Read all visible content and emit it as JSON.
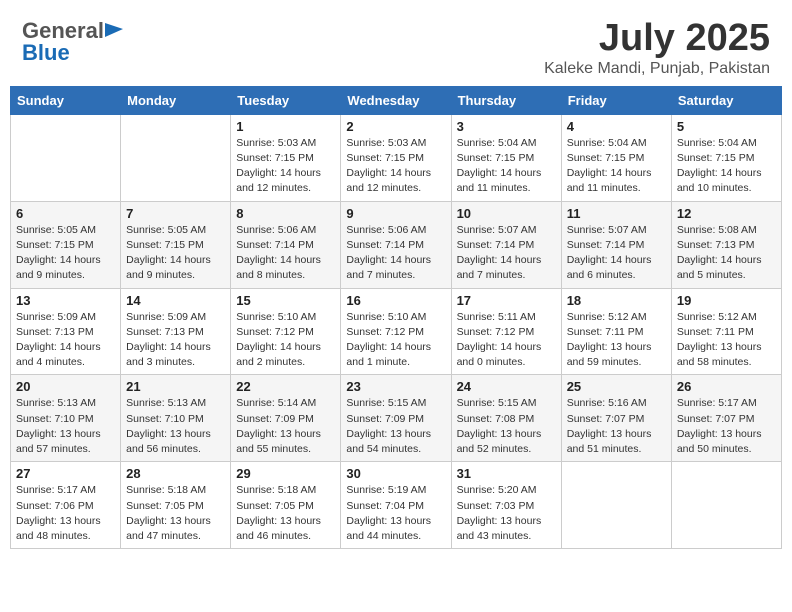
{
  "header": {
    "logo_general": "General",
    "logo_blue": "Blue",
    "month_title": "July 2025",
    "location": "Kaleke Mandi, Punjab, Pakistan"
  },
  "columns": [
    "Sunday",
    "Monday",
    "Tuesday",
    "Wednesday",
    "Thursday",
    "Friday",
    "Saturday"
  ],
  "weeks": [
    [
      {
        "day": "",
        "sunrise": "",
        "sunset": "",
        "daylight": ""
      },
      {
        "day": "",
        "sunrise": "",
        "sunset": "",
        "daylight": ""
      },
      {
        "day": "1",
        "sunrise": "Sunrise: 5:03 AM",
        "sunset": "Sunset: 7:15 PM",
        "daylight": "Daylight: 14 hours and 12 minutes."
      },
      {
        "day": "2",
        "sunrise": "Sunrise: 5:03 AM",
        "sunset": "Sunset: 7:15 PM",
        "daylight": "Daylight: 14 hours and 12 minutes."
      },
      {
        "day": "3",
        "sunrise": "Sunrise: 5:04 AM",
        "sunset": "Sunset: 7:15 PM",
        "daylight": "Daylight: 14 hours and 11 minutes."
      },
      {
        "day": "4",
        "sunrise": "Sunrise: 5:04 AM",
        "sunset": "Sunset: 7:15 PM",
        "daylight": "Daylight: 14 hours and 11 minutes."
      },
      {
        "day": "5",
        "sunrise": "Sunrise: 5:04 AM",
        "sunset": "Sunset: 7:15 PM",
        "daylight": "Daylight: 14 hours and 10 minutes."
      }
    ],
    [
      {
        "day": "6",
        "sunrise": "Sunrise: 5:05 AM",
        "sunset": "Sunset: 7:15 PM",
        "daylight": "Daylight: 14 hours and 9 minutes."
      },
      {
        "day": "7",
        "sunrise": "Sunrise: 5:05 AM",
        "sunset": "Sunset: 7:15 PM",
        "daylight": "Daylight: 14 hours and 9 minutes."
      },
      {
        "day": "8",
        "sunrise": "Sunrise: 5:06 AM",
        "sunset": "Sunset: 7:14 PM",
        "daylight": "Daylight: 14 hours and 8 minutes."
      },
      {
        "day": "9",
        "sunrise": "Sunrise: 5:06 AM",
        "sunset": "Sunset: 7:14 PM",
        "daylight": "Daylight: 14 hours and 7 minutes."
      },
      {
        "day": "10",
        "sunrise": "Sunrise: 5:07 AM",
        "sunset": "Sunset: 7:14 PM",
        "daylight": "Daylight: 14 hours and 7 minutes."
      },
      {
        "day": "11",
        "sunrise": "Sunrise: 5:07 AM",
        "sunset": "Sunset: 7:14 PM",
        "daylight": "Daylight: 14 hours and 6 minutes."
      },
      {
        "day": "12",
        "sunrise": "Sunrise: 5:08 AM",
        "sunset": "Sunset: 7:13 PM",
        "daylight": "Daylight: 14 hours and 5 minutes."
      }
    ],
    [
      {
        "day": "13",
        "sunrise": "Sunrise: 5:09 AM",
        "sunset": "Sunset: 7:13 PM",
        "daylight": "Daylight: 14 hours and 4 minutes."
      },
      {
        "day": "14",
        "sunrise": "Sunrise: 5:09 AM",
        "sunset": "Sunset: 7:13 PM",
        "daylight": "Daylight: 14 hours and 3 minutes."
      },
      {
        "day": "15",
        "sunrise": "Sunrise: 5:10 AM",
        "sunset": "Sunset: 7:12 PM",
        "daylight": "Daylight: 14 hours and 2 minutes."
      },
      {
        "day": "16",
        "sunrise": "Sunrise: 5:10 AM",
        "sunset": "Sunset: 7:12 PM",
        "daylight": "Daylight: 14 hours and 1 minute."
      },
      {
        "day": "17",
        "sunrise": "Sunrise: 5:11 AM",
        "sunset": "Sunset: 7:12 PM",
        "daylight": "Daylight: 14 hours and 0 minutes."
      },
      {
        "day": "18",
        "sunrise": "Sunrise: 5:12 AM",
        "sunset": "Sunset: 7:11 PM",
        "daylight": "Daylight: 13 hours and 59 minutes."
      },
      {
        "day": "19",
        "sunrise": "Sunrise: 5:12 AM",
        "sunset": "Sunset: 7:11 PM",
        "daylight": "Daylight: 13 hours and 58 minutes."
      }
    ],
    [
      {
        "day": "20",
        "sunrise": "Sunrise: 5:13 AM",
        "sunset": "Sunset: 7:10 PM",
        "daylight": "Daylight: 13 hours and 57 minutes."
      },
      {
        "day": "21",
        "sunrise": "Sunrise: 5:13 AM",
        "sunset": "Sunset: 7:10 PM",
        "daylight": "Daylight: 13 hours and 56 minutes."
      },
      {
        "day": "22",
        "sunrise": "Sunrise: 5:14 AM",
        "sunset": "Sunset: 7:09 PM",
        "daylight": "Daylight: 13 hours and 55 minutes."
      },
      {
        "day": "23",
        "sunrise": "Sunrise: 5:15 AM",
        "sunset": "Sunset: 7:09 PM",
        "daylight": "Daylight: 13 hours and 54 minutes."
      },
      {
        "day": "24",
        "sunrise": "Sunrise: 5:15 AM",
        "sunset": "Sunset: 7:08 PM",
        "daylight": "Daylight: 13 hours and 52 minutes."
      },
      {
        "day": "25",
        "sunrise": "Sunrise: 5:16 AM",
        "sunset": "Sunset: 7:07 PM",
        "daylight": "Daylight: 13 hours and 51 minutes."
      },
      {
        "day": "26",
        "sunrise": "Sunrise: 5:17 AM",
        "sunset": "Sunset: 7:07 PM",
        "daylight": "Daylight: 13 hours and 50 minutes."
      }
    ],
    [
      {
        "day": "27",
        "sunrise": "Sunrise: 5:17 AM",
        "sunset": "Sunset: 7:06 PM",
        "daylight": "Daylight: 13 hours and 48 minutes."
      },
      {
        "day": "28",
        "sunrise": "Sunrise: 5:18 AM",
        "sunset": "Sunset: 7:05 PM",
        "daylight": "Daylight: 13 hours and 47 minutes."
      },
      {
        "day": "29",
        "sunrise": "Sunrise: 5:18 AM",
        "sunset": "Sunset: 7:05 PM",
        "daylight": "Daylight: 13 hours and 46 minutes."
      },
      {
        "day": "30",
        "sunrise": "Sunrise: 5:19 AM",
        "sunset": "Sunset: 7:04 PM",
        "daylight": "Daylight: 13 hours and 44 minutes."
      },
      {
        "day": "31",
        "sunrise": "Sunrise: 5:20 AM",
        "sunset": "Sunset: 7:03 PM",
        "daylight": "Daylight: 13 hours and 43 minutes."
      },
      {
        "day": "",
        "sunrise": "",
        "sunset": "",
        "daylight": ""
      },
      {
        "day": "",
        "sunrise": "",
        "sunset": "",
        "daylight": ""
      }
    ]
  ]
}
